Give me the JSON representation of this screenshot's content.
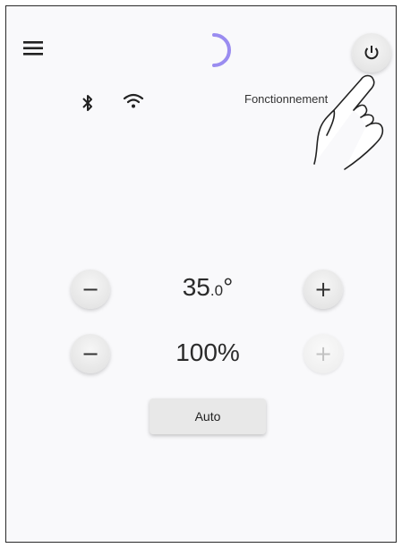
{
  "header": {
    "menu_icon": "hamburger-menu-icon",
    "loading_icon": "loading-spinner-icon",
    "power_icon": "power-icon",
    "accent_color": "#9a8cf0"
  },
  "status_bar": {
    "bluetooth_icon": "bluetooth-icon",
    "wifi_icon": "wifi-icon",
    "status_text": "Fonctionnement"
  },
  "temperature": {
    "value_main": "35",
    "value_decimal": ".0",
    "unit": "°",
    "decrease_label": "−",
    "increase_label": "+"
  },
  "fan": {
    "value": "100%",
    "decrease_label": "−",
    "increase_label": "+"
  },
  "auto_button": {
    "label": "Auto"
  },
  "overlay": {
    "hand_icon": "pointing-hand-icon"
  }
}
